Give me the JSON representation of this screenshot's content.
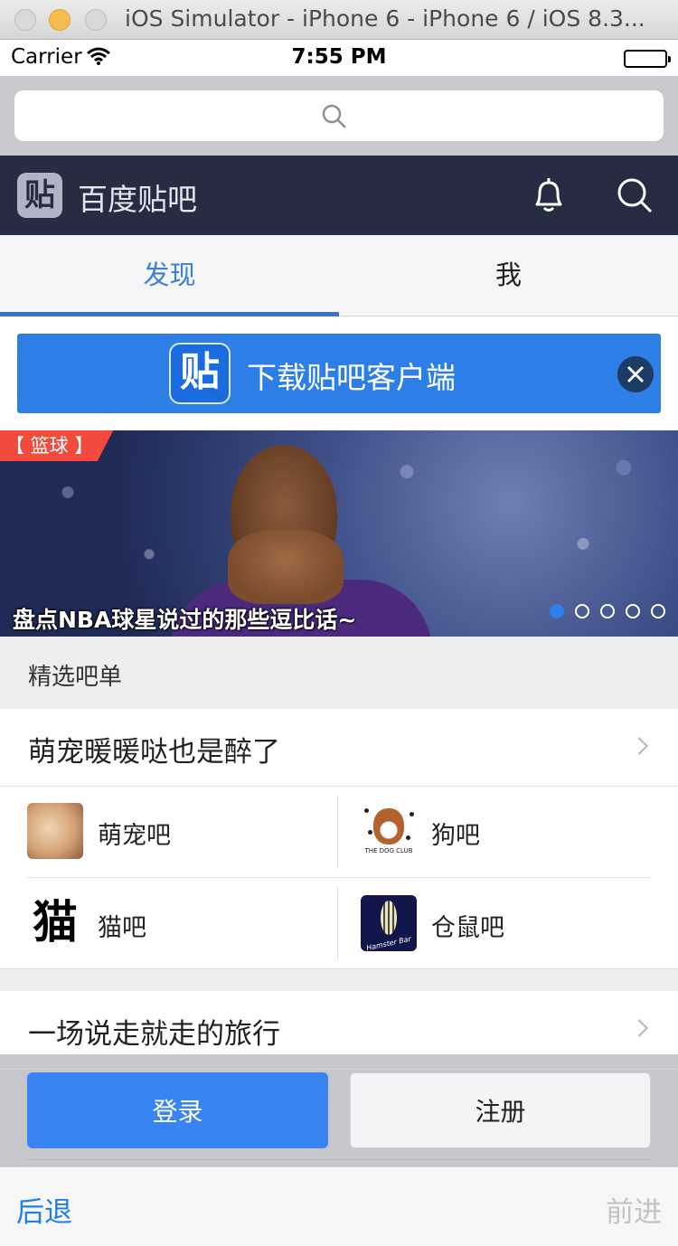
{
  "window": {
    "title": "iOS Simulator - iPhone 6 - iPhone 6 / iOS 8.3..."
  },
  "statusbar": {
    "carrier": "Carrier",
    "time": "7:55 PM"
  },
  "search": {
    "placeholder": ""
  },
  "app": {
    "logo_char": "贴",
    "name": "百度贴吧"
  },
  "tabs": [
    {
      "label": "发现",
      "active": true
    },
    {
      "label": "我",
      "active": false
    }
  ],
  "download_banner": {
    "icon_char": "贴",
    "text": "下载贴吧客户端"
  },
  "hero": {
    "tag": "【 篮球 】",
    "caption": "盘点NBA球星说过的那些逗比话~",
    "page_count": 5,
    "active_page": 1
  },
  "section": {
    "title": "精选吧单"
  },
  "lists": [
    {
      "title": "萌宠暖暖哒也是醉了",
      "bars": [
        {
          "name": "萌宠吧",
          "avatar": "kitten-avatar"
        },
        {
          "name": "狗吧",
          "avatar": "dog-club-avatar",
          "avatar_text": "THE DOG CLUB"
        },
        {
          "name": "猫吧",
          "avatar": "cat-glyph-avatar",
          "avatar_text": "猫"
        },
        {
          "name": "仓鼠吧",
          "avatar": "hamster-bar-avatar",
          "avatar_text": "Hamster Bar"
        }
      ]
    },
    {
      "title": "一场说走就走的旅行"
    }
  ],
  "actions": {
    "login": "登录",
    "register": "注册"
  },
  "toolbar": {
    "back": "后退",
    "forward": "前进"
  },
  "colors": {
    "accent": "#3884f2",
    "header_bg": "#262c41",
    "tag_red": "#f24a3c"
  }
}
